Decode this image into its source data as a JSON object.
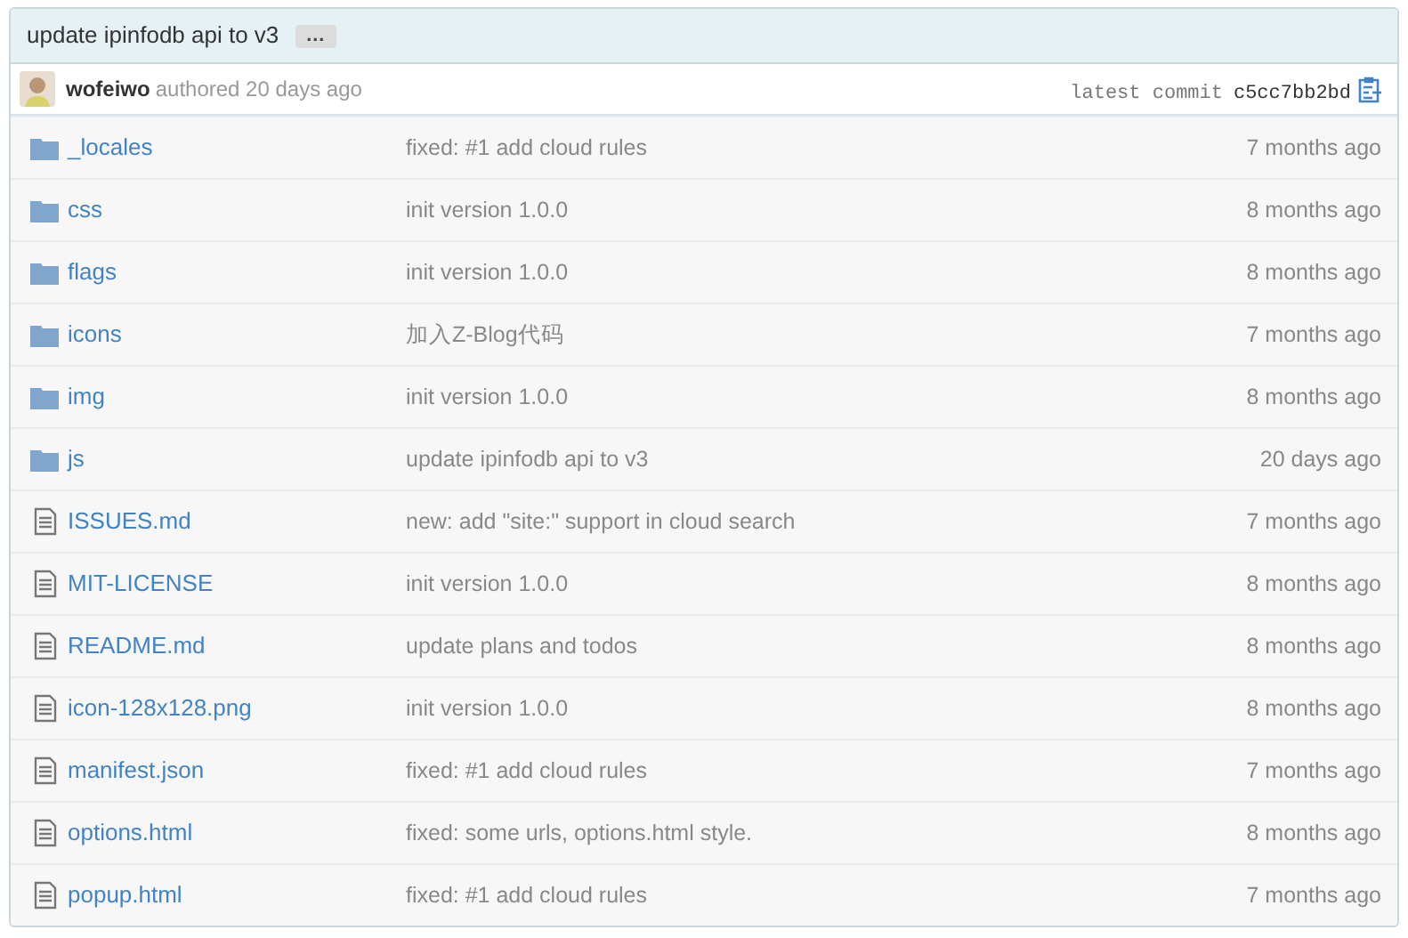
{
  "commit": {
    "message": "update ipinfodb api to v3",
    "more": "…",
    "author": "wofeiwo",
    "authored": "authored 20 days ago",
    "latest_label": "latest commit",
    "sha": "c5cc7bb2bd"
  },
  "files": [
    {
      "kind": "folder",
      "name": "_locales",
      "message": "fixed: #1 add cloud rules",
      "age": "7 months ago"
    },
    {
      "kind": "folder",
      "name": "css",
      "message": "init version 1.0.0",
      "age": "8 months ago"
    },
    {
      "kind": "folder",
      "name": "flags",
      "message": "init version 1.0.0",
      "age": "8 months ago"
    },
    {
      "kind": "folder",
      "name": "icons",
      "message": "加入Z-Blog代码",
      "age": "7 months ago"
    },
    {
      "kind": "folder",
      "name": "img",
      "message": "init version 1.0.0",
      "age": "8 months ago"
    },
    {
      "kind": "folder",
      "name": "js",
      "message": "update ipinfodb api to v3",
      "age": "20 days ago"
    },
    {
      "kind": "file",
      "name": "ISSUES.md",
      "message": "new: add \"site:\" support in cloud search",
      "age": "7 months ago"
    },
    {
      "kind": "file",
      "name": "MIT-LICENSE",
      "message": "init version 1.0.0",
      "age": "8 months ago"
    },
    {
      "kind": "file",
      "name": "README.md",
      "message": "update plans and todos",
      "age": "8 months ago"
    },
    {
      "kind": "file",
      "name": "icon-128x128.png",
      "message": "init version 1.0.0",
      "age": "8 months ago"
    },
    {
      "kind": "file",
      "name": "manifest.json",
      "message": "fixed: #1 add cloud rules",
      "age": "7 months ago"
    },
    {
      "kind": "file",
      "name": "options.html",
      "message": "fixed: some urls, options.html style.",
      "age": "8 months ago"
    },
    {
      "kind": "file",
      "name": "popup.html",
      "message": "fixed: #1 add cloud rules",
      "age": "7 months ago"
    }
  ]
}
